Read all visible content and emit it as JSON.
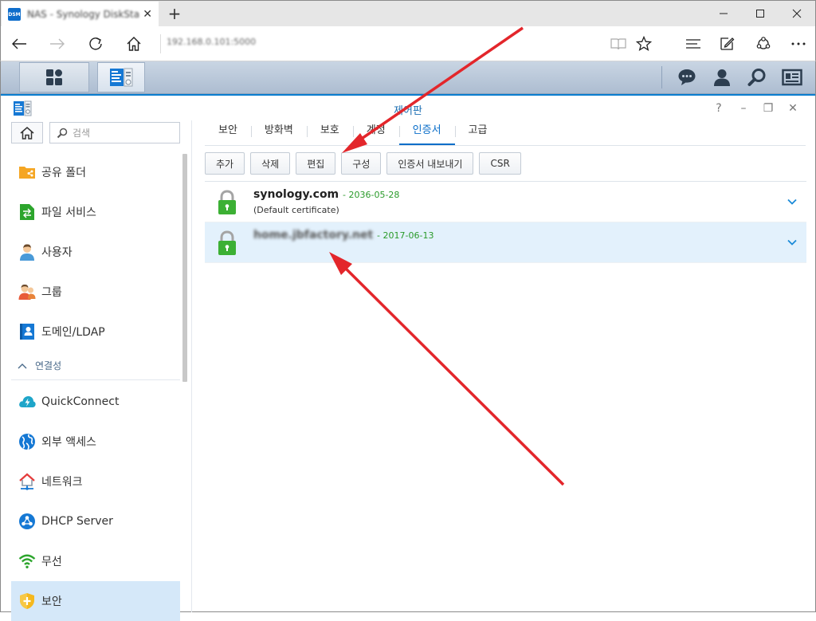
{
  "browser": {
    "tab_title": "NAS - Synology DiskStation",
    "favicon_text": "DSM",
    "url": "192.168.0.101:5000",
    "new_tab": "+",
    "tab_close": "✕"
  },
  "window": {
    "title": "제어판",
    "controls": [
      "?",
      "–",
      "❐",
      "✕"
    ]
  },
  "sidebar": {
    "search_placeholder": "검색",
    "items_top": [
      {
        "label": "공유 폴더",
        "icon": "shared-folder-icon"
      },
      {
        "label": "파일 서비스",
        "icon": "file-services-icon"
      },
      {
        "label": "사용자",
        "icon": "user-icon"
      },
      {
        "label": "그룹",
        "icon": "group-icon"
      },
      {
        "label": "도메인/LDAP",
        "icon": "domain-ldap-icon"
      }
    ],
    "section_label": "연결성",
    "items_bottom": [
      {
        "label": "QuickConnect",
        "icon": "quickconnect-icon"
      },
      {
        "label": "외부 액세스",
        "icon": "external-access-icon"
      },
      {
        "label": "네트워크",
        "icon": "network-icon"
      },
      {
        "label": "DHCP Server",
        "icon": "dhcp-server-icon"
      },
      {
        "label": "무선",
        "icon": "wireless-icon"
      },
      {
        "label": "보안",
        "icon": "security-icon",
        "active": true
      }
    ]
  },
  "tabs": [
    "보안",
    "방화벽",
    "보호",
    "계정",
    "인증서",
    "고급"
  ],
  "active_tab": "인증서",
  "toolbar": [
    "추가",
    "삭제",
    "편집",
    "구성",
    "인증서 내보내기",
    "CSR"
  ],
  "certificates": [
    {
      "name": "synology.com",
      "date": "- 2036-05-28",
      "sub": "(Default certificate)"
    },
    {
      "name": "home.jbfactory.net",
      "date": "- 2017-06-13",
      "sub": ""
    }
  ],
  "colors": {
    "accent": "#0a6ec9",
    "date_green": "#2a9a2a",
    "arrow_red": "#e3262b",
    "lock_green": "#3cb034"
  }
}
